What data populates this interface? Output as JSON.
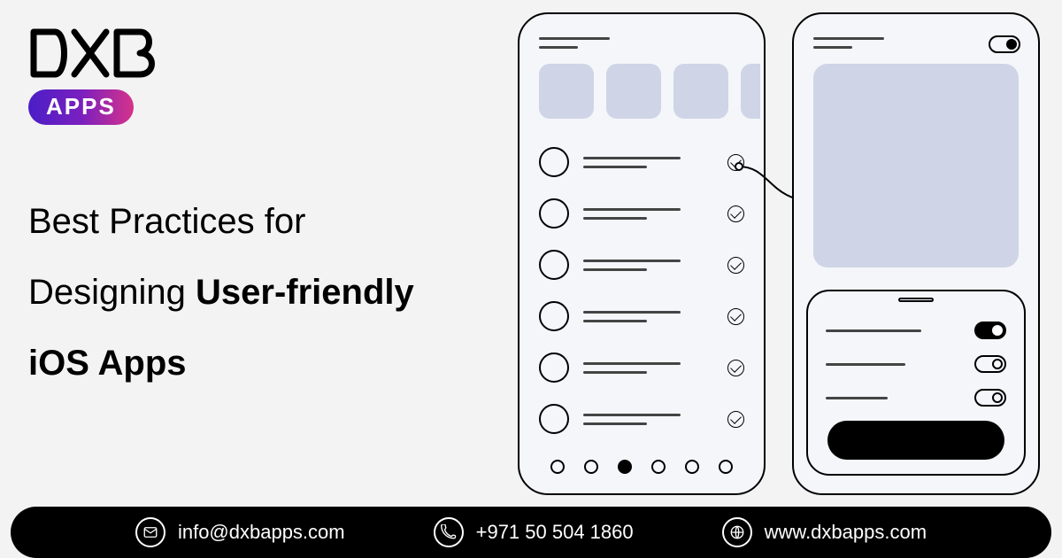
{
  "logo": {
    "brand": "DXB",
    "badge": "APPS"
  },
  "headline": {
    "line1": "Best Practices for",
    "line2_pre": "Designing ",
    "line2_bold": "User-friendly",
    "line3_bold": "iOS Apps"
  },
  "wireframe": {
    "left_items_count": 6,
    "pagination_active_index": 2,
    "pagination_count": 6,
    "toggles": [
      "on",
      "off",
      "off"
    ]
  },
  "contact": {
    "email": "info@dxbapps.com",
    "phone": "+971 50 504 1860",
    "website": "www.dxbapps.com"
  }
}
